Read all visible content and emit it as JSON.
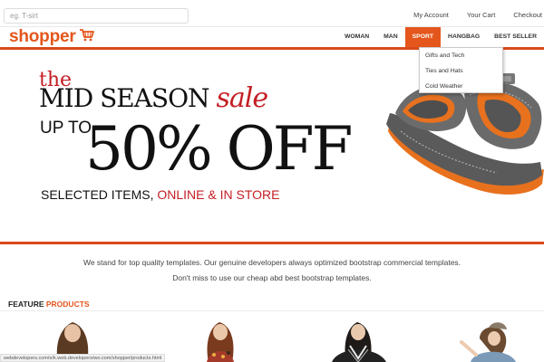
{
  "search": {
    "placeholder": "eg. T-sirt",
    "value": ""
  },
  "top_links": {
    "account": "My Account",
    "cart": "Your Cart",
    "checkout": "Checkout"
  },
  "logo": {
    "text": "shopper",
    "icon": "cart-icon"
  },
  "nav": {
    "woman": "WOMAN",
    "man": "MAN",
    "sport": "SPORT",
    "hangbag": "HANGBAG",
    "best_seller": "BEST SELLER",
    "active": "SPORT"
  },
  "dropdown": {
    "items": [
      "Gifts and Tech",
      "Ties and Hats",
      "Cold Weather"
    ]
  },
  "hero": {
    "the": "the",
    "mid_season": "MID SEASON",
    "sale": "sale",
    "up_to": "UP TO",
    "percent_off": "50% OFF",
    "selected_items": "SELECTED ITEMS, ",
    "online_in_store": "ONLINE & IN STORE",
    "image": "sandal-shoe-image"
  },
  "tagline": {
    "line1": "We stand for top quality templates. Our genuine developers always optimized bootstrap commercial templates.",
    "line2": "Don't miss to use our cheap abd best bootstrap templates."
  },
  "feature": {
    "prefix": "FEATURE ",
    "accent": "PRODUCTS"
  },
  "status_url": "webdevelopers.com/e/k.web.developers/wo.com/shopper/products.html",
  "colors": {
    "brand": "#e4561c",
    "sale_red": "#c41e25",
    "rule": "#d9491a"
  }
}
